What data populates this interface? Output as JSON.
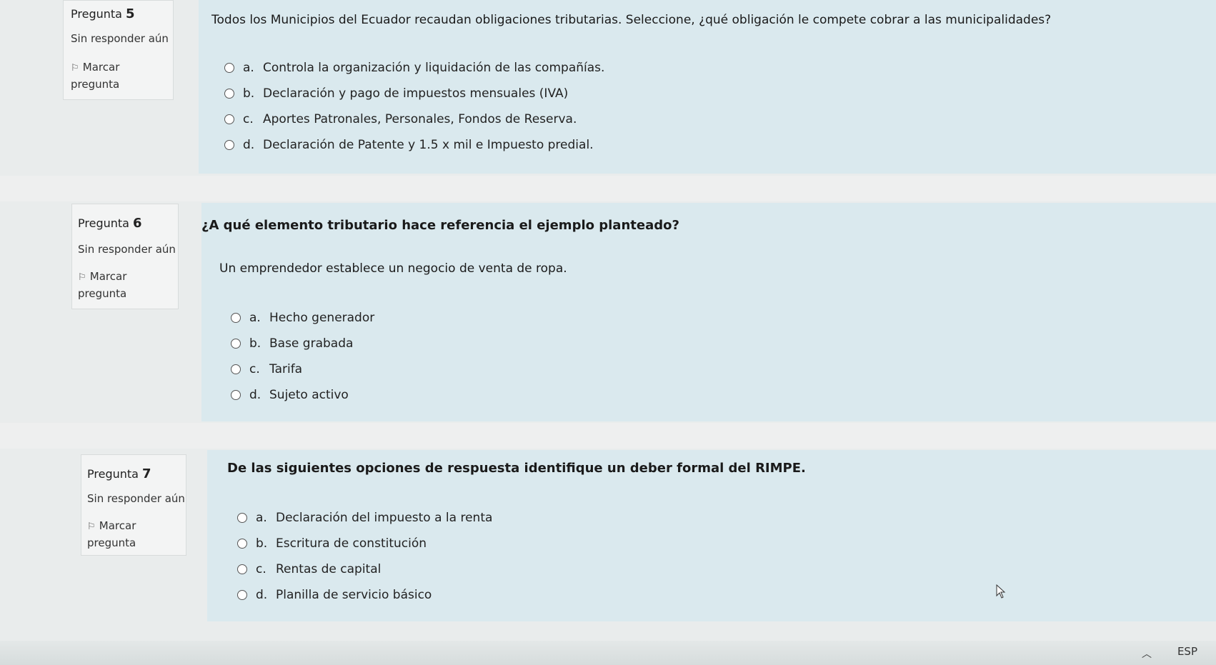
{
  "questions": [
    {
      "label": "Pregunta",
      "number": "5",
      "state": "Sin responder aún",
      "flag_label_1": "Marcar",
      "flag_label_2": "pregunta",
      "text": "Todos los Municipios del Ecuador recaudan obligaciones tributarias. Seleccione, ¿qué obligación le compete cobrar a las municipalidades?",
      "example": "",
      "answers": [
        {
          "letter": "a.",
          "text": "Controla la organización y liquidación de las compañías."
        },
        {
          "letter": "b.",
          "text": "Declaración y pago de impuestos mensuales (IVA)"
        },
        {
          "letter": "c.",
          "text": "Aportes Patronales, Personales, Fondos de Reserva."
        },
        {
          "letter": "d.",
          "text": "Declaración de Patente y 1.5 x mil e Impuesto predial."
        }
      ]
    },
    {
      "label": "Pregunta",
      "number": "6",
      "state": "Sin responder aún",
      "flag_label_1": "Marcar",
      "flag_label_2": "pregunta",
      "text": "¿A qué elemento tributario hace referencia el ejemplo planteado?",
      "example": "Un emprendedor establece un negocio de venta de ropa.",
      "answers": [
        {
          "letter": "a.",
          "text": "Hecho generador"
        },
        {
          "letter": "b.",
          "text": "Base grabada"
        },
        {
          "letter": "c.",
          "text": "Tarifa"
        },
        {
          "letter": "d.",
          "text": "Sujeto activo"
        }
      ]
    },
    {
      "label": "Pregunta",
      "number": "7",
      "state": "Sin responder aún",
      "flag_label_1": "Marcar",
      "flag_label_2": "pregunta",
      "text": "De las siguientes opciones de respuesta identifique un deber formal del RIMPE.",
      "example": "",
      "answers": [
        {
          "letter": "a.",
          "text": "Declaración del impuesto a la renta"
        },
        {
          "letter": "b.",
          "text": "Escritura de constitución"
        },
        {
          "letter": "c.",
          "text": "Rentas de capital"
        },
        {
          "letter": "d.",
          "text": "Planilla de servicio básico"
        }
      ]
    }
  ],
  "taskbar": {
    "language": "ESP"
  }
}
